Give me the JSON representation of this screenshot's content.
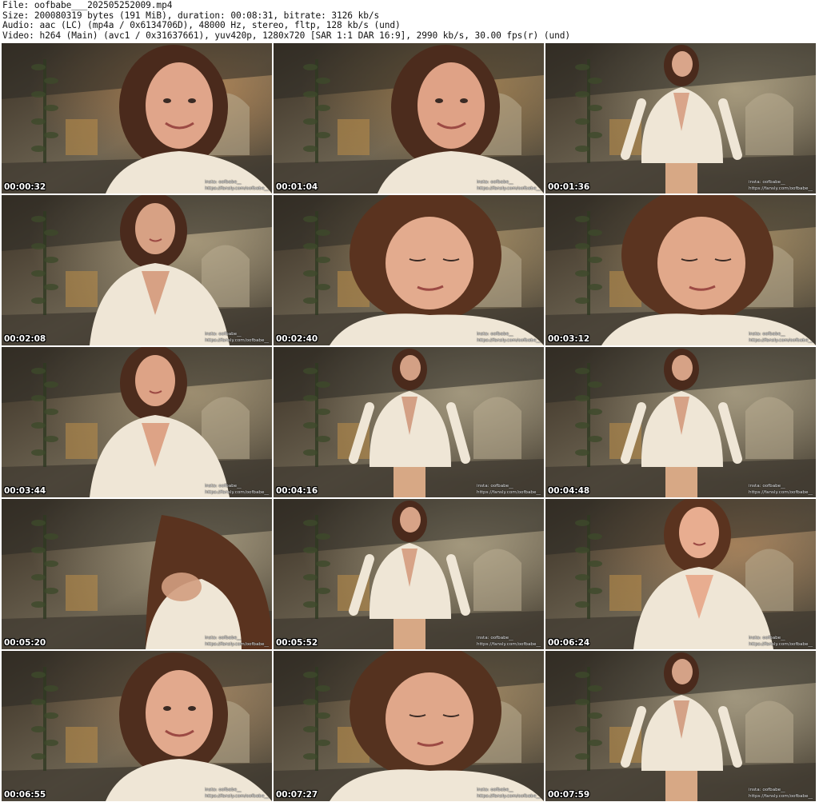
{
  "header": {
    "file": "File: oofbabe___202505252009.mp4",
    "size": "Size: 200080319 bytes (191 MiB), duration: 00:08:31, bitrate: 3126 kb/s",
    "audio": "Audio: aac (LC) (mp4a / 0x6134706D), 48000 Hz, stereo, fltp, 128 kb/s (und)",
    "video": "Video: h264 (Main) (avc1 / 0x31637661), yuv420p, 1280x720 [SAR 1:1 DAR 16:9], 2990 kb/s, 30.00 fps(r) (und)"
  },
  "watermark": {
    "line1": "insta: oofbabe__",
    "line2": "https://fansly.com/oofbabe__"
  },
  "thumbnails": [
    {
      "time": "00:00:32",
      "scene": "close",
      "skin": "#e0a58a",
      "hair": "#4a2a1c",
      "light": "#e7a05a"
    },
    {
      "time": "00:01:04",
      "scene": "close",
      "skin": "#dfa286",
      "hair": "#4c2c1d",
      "light": "#c7934f"
    },
    {
      "time": "00:01:36",
      "scene": "full",
      "skin": "#d9a58a",
      "hair": "#4a2a1c",
      "light": "#d8c9a3"
    },
    {
      "time": "00:02:08",
      "scene": "mid",
      "skin": "#d7a184",
      "hair": "#4a2a1c",
      "light": "#d5c39c"
    },
    {
      "time": "00:02:40",
      "scene": "down",
      "skin": "#e3ab8e",
      "hair": "#5a331f",
      "light": "#c8a56c"
    },
    {
      "time": "00:03:12",
      "scene": "down",
      "skin": "#e1a88a",
      "hair": "#5b3420",
      "light": "#c8a56c"
    },
    {
      "time": "00:03:44",
      "scene": "mid",
      "skin": "#dda386",
      "hair": "#4c2c1d",
      "light": "#c7b38c"
    },
    {
      "time": "00:04:16",
      "scene": "full",
      "skin": "#d3a085",
      "hair": "#4a2a1c",
      "light": "#d0c4a4"
    },
    {
      "time": "00:04:48",
      "scene": "full",
      "skin": "#d6a286",
      "hair": "#4a2a1c",
      "light": "#d0c4a4"
    },
    {
      "time": "00:05:20",
      "scene": "hair",
      "skin": "#d19d80",
      "hair": "#5a331f",
      "light": "#cfc1a0"
    },
    {
      "time": "00:05:52",
      "scene": "full",
      "skin": "#d7a387",
      "hair": "#4a2a1c",
      "light": "#d3c6a4"
    },
    {
      "time": "00:06:24",
      "scene": "mid",
      "skin": "#e8ad90",
      "hair": "#5a331f",
      "light": "#d39a64"
    },
    {
      "time": "00:06:55",
      "scene": "close",
      "skin": "#e2a98d",
      "hair": "#4f2e1e",
      "light": "#c79a6a"
    },
    {
      "time": "00:07:27",
      "scene": "down",
      "skin": "#e0a78a",
      "hair": "#55321f",
      "light": "#c5a06c"
    },
    {
      "time": "00:07:59",
      "scene": "full",
      "skin": "#d4a287",
      "hair": "#4a2a1c",
      "light": "#cfc4a6"
    }
  ]
}
